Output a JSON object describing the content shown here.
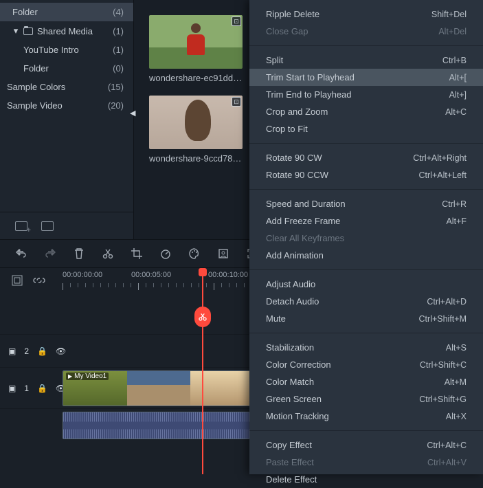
{
  "sidebar": {
    "items": [
      {
        "label": "Folder",
        "count": "(4)"
      },
      {
        "label": "Shared Media",
        "count": "(1)"
      },
      {
        "label": "YouTube Intro",
        "count": "(1)"
      },
      {
        "label": "Folder",
        "count": "(0)"
      },
      {
        "label": "Sample Colors",
        "count": "(15)"
      },
      {
        "label": "Sample Video",
        "count": "(20)"
      }
    ]
  },
  "media": {
    "clips": [
      {
        "caption": "wondershare-ec91dd68-…"
      },
      {
        "caption": "wondershare-9ccd78f6-6…"
      }
    ]
  },
  "ruler": {
    "tc": [
      "00:00:00:00",
      "00:00:05:00",
      "00:00:10:00"
    ]
  },
  "video_clip": {
    "label": "My Video1"
  },
  "track_labels": {
    "t2": "2",
    "t1": "1"
  },
  "context_menu": [
    {
      "label": "Ripple Delete",
      "shortcut": "Shift+Del"
    },
    {
      "label": "Close Gap",
      "shortcut": "Alt+Del",
      "disabled": true
    },
    {
      "sep": true
    },
    {
      "label": "Split",
      "shortcut": "Ctrl+B"
    },
    {
      "label": "Trim Start to Playhead",
      "shortcut": "Alt+[",
      "highlight": true
    },
    {
      "label": "Trim End to Playhead",
      "shortcut": "Alt+]"
    },
    {
      "label": "Crop and Zoom",
      "shortcut": "Alt+C"
    },
    {
      "label": "Crop to Fit",
      "shortcut": ""
    },
    {
      "sep": true
    },
    {
      "label": "Rotate 90 CW",
      "shortcut": "Ctrl+Alt+Right"
    },
    {
      "label": "Rotate 90 CCW",
      "shortcut": "Ctrl+Alt+Left"
    },
    {
      "sep": true
    },
    {
      "label": "Speed and Duration",
      "shortcut": "Ctrl+R"
    },
    {
      "label": "Add Freeze Frame",
      "shortcut": "Alt+F"
    },
    {
      "label": "Clear All Keyframes",
      "shortcut": "",
      "disabled": true
    },
    {
      "label": "Add Animation",
      "shortcut": ""
    },
    {
      "sep": true
    },
    {
      "label": "Adjust Audio",
      "shortcut": ""
    },
    {
      "label": "Detach Audio",
      "shortcut": "Ctrl+Alt+D"
    },
    {
      "label": "Mute",
      "shortcut": "Ctrl+Shift+M"
    },
    {
      "sep": true
    },
    {
      "label": "Stabilization",
      "shortcut": "Alt+S"
    },
    {
      "label": "Color Correction",
      "shortcut": "Ctrl+Shift+C"
    },
    {
      "label": "Color Match",
      "shortcut": "Alt+M"
    },
    {
      "label": "Green Screen",
      "shortcut": "Ctrl+Shift+G"
    },
    {
      "label": "Motion Tracking",
      "shortcut": "Alt+X"
    },
    {
      "sep": true
    },
    {
      "label": "Copy Effect",
      "shortcut": "Ctrl+Alt+C"
    },
    {
      "label": "Paste Effect",
      "shortcut": "Ctrl+Alt+V",
      "disabled": true
    },
    {
      "label": "Delete Effect",
      "shortcut": ""
    }
  ]
}
